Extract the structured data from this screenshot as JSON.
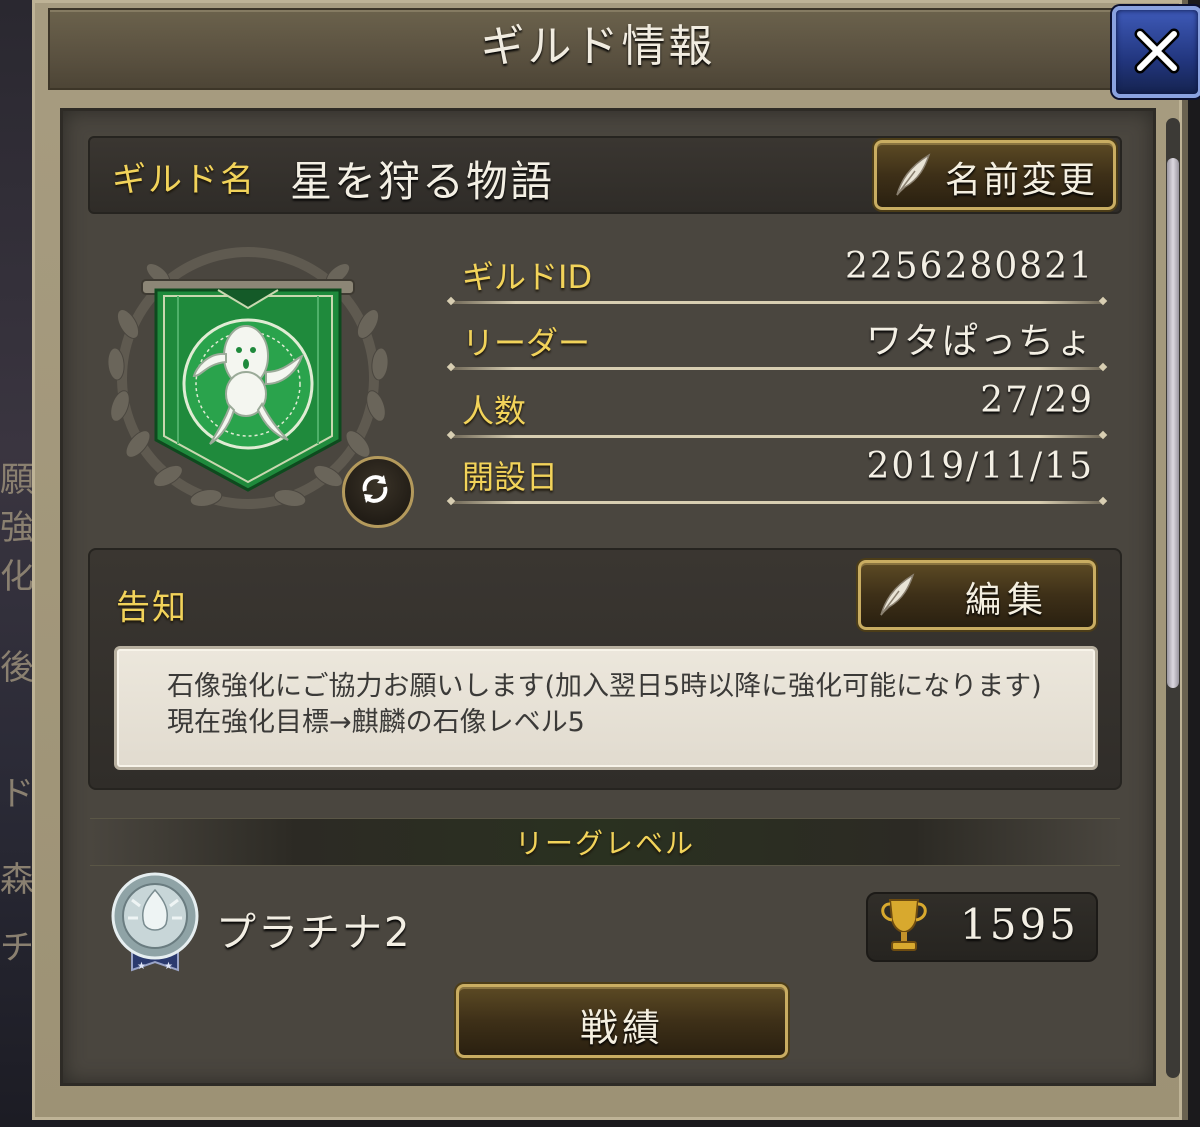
{
  "window": {
    "title": "ギルド情報"
  },
  "background": {
    "partial_texts": [
      "願",
      "強化",
      "後",
      "ド",
      "森",
      "チ"
    ]
  },
  "guild": {
    "name_label": "ギルド名",
    "name_value": "星を狩る物語",
    "rename_label": "名前変更",
    "info": [
      {
        "label": "ギルドID",
        "value": "2256280821"
      },
      {
        "label": "リーダー",
        "value": "ワタぱっちょ"
      },
      {
        "label": "人数",
        "value": "27/29"
      },
      {
        "label": "開設日",
        "value": "2019/11/15"
      }
    ]
  },
  "notice": {
    "label": "告知",
    "edit_label": "編集",
    "text": "石像強化にご協力お願いします(加入翌日5時以降に強化可能になります)現在強化目標→麒麟の石像レベル5"
  },
  "league": {
    "label": "リーグレベル",
    "rank": "プラチナ2",
    "trophies": "1595"
  },
  "record_button": "戦績",
  "colors": {
    "gold_text": "#f2d35a",
    "panel": "#4a463f",
    "close_button": "#22367e",
    "emblem_green": "#1f8a3c"
  },
  "icons": [
    "close-icon",
    "quill-icon",
    "swap-icon",
    "cactuar-emblem-icon",
    "platinum-medal-icon",
    "trophy-icon"
  ]
}
